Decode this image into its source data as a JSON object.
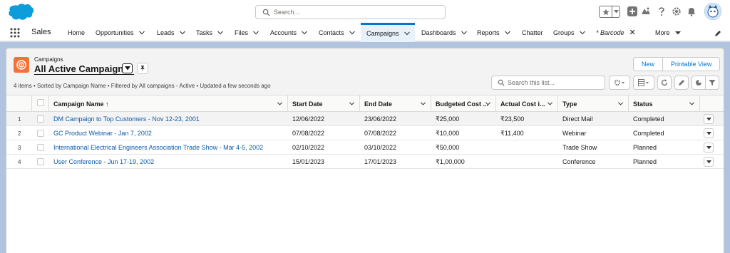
{
  "global_header": {
    "search_placeholder": "Search..."
  },
  "app_nav": {
    "app_name": "Sales",
    "items": [
      {
        "label": "Home",
        "has_dropdown": false
      },
      {
        "label": "Opportunities",
        "has_dropdown": true
      },
      {
        "label": "Leads",
        "has_dropdown": true
      },
      {
        "label": "Tasks",
        "has_dropdown": true
      },
      {
        "label": "Files",
        "has_dropdown": true
      },
      {
        "label": "Accounts",
        "has_dropdown": true
      },
      {
        "label": "Contacts",
        "has_dropdown": true
      },
      {
        "label": "Campaigns",
        "has_dropdown": true,
        "active": true
      },
      {
        "label": "Dashboards",
        "has_dropdown": true
      },
      {
        "label": "Reports",
        "has_dropdown": true
      },
      {
        "label": "Chatter",
        "has_dropdown": false
      },
      {
        "label": "Groups",
        "has_dropdown": true
      },
      {
        "label": "* Barcode",
        "has_dropdown": false,
        "closable": true
      },
      {
        "label": "More",
        "has_dropdown": true
      }
    ]
  },
  "list_view": {
    "object_label": "Campaigns",
    "title": "All Active Campaigns",
    "meta": "4 items • Sorted by Campaign Name • Filtered by All campaigns - Active • Updated a few seconds ago",
    "buttons": {
      "new": "New",
      "printable_view": "Printable View"
    },
    "search_placeholder": "Search this list..."
  },
  "table": {
    "columns": [
      "Campaign Name ↑",
      "Start Date",
      "End Date",
      "Budgeted Cost ...",
      "Actual Cost i...",
      "Type",
      "Status"
    ],
    "rows": [
      {
        "num": "1",
        "name": "DM Campaign to Top Customers - Nov 12-23, 2001",
        "start": "12/06/2022",
        "end": "23/06/2022",
        "budget": "₹25,000",
        "actual": "₹23,500",
        "type": "Direct Mail",
        "status": "Completed"
      },
      {
        "num": "2",
        "name": "GC Product Webinar - Jan 7, 2002",
        "start": "07/08/2022",
        "end": "07/08/2022",
        "budget": "₹10,000",
        "actual": "₹11,400",
        "type": "Webinar",
        "status": "Completed"
      },
      {
        "num": "3",
        "name": "International Electrical Engineers Association Trade Show - Mar 4-5, 2002",
        "start": "02/10/2022",
        "end": "03/10/2022",
        "budget": "₹50,000",
        "actual": "",
        "type": "Trade Show",
        "status": "Planned"
      },
      {
        "num": "4",
        "name": "User Conference - Jun 17-19, 2002",
        "start": "15/01/2023",
        "end": "17/01/2023",
        "budget": "₹1,00,000",
        "actual": "",
        "type": "Conference",
        "status": "Planned"
      }
    ]
  },
  "colors": {
    "brand": "#0176d3",
    "campaign_icon": "#f4713a",
    "link": "#0b5cab",
    "background": "#b0c4df"
  }
}
